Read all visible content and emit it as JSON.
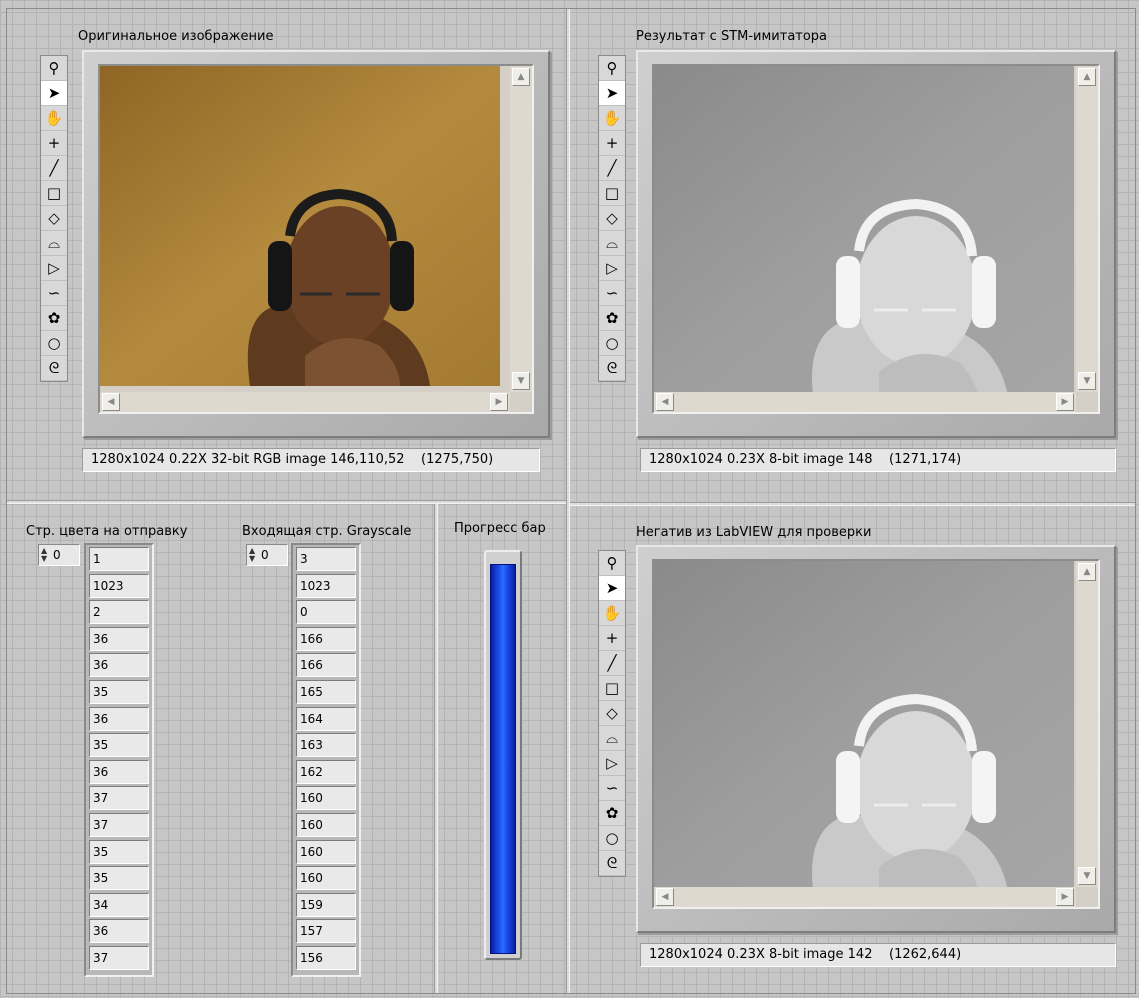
{
  "panels": {
    "original": {
      "title": "Оригинальное изображение",
      "status": "1280x1024 0.22X 32-bit RGB image 146,110,52    (1275,750)"
    },
    "stm_result": {
      "title": "Результат с STM-имитатора",
      "status": "1280x1024 0.23X 8-bit image 148    (1271,174)"
    },
    "negative": {
      "title": "Негатив из LabVIEW для проверки",
      "status": "1280x1024 0.23X 8-bit image 142    (1262,644)"
    }
  },
  "tools": [
    {
      "name": "zoom-icon",
      "glyph": "⚲"
    },
    {
      "name": "pointer-icon",
      "glyph": "➤"
    },
    {
      "name": "pan-hand-icon",
      "glyph": "✋"
    },
    {
      "name": "point-icon",
      "glyph": "+"
    },
    {
      "name": "line-icon",
      "glyph": "╱"
    },
    {
      "name": "rectangle-icon",
      "glyph": "□"
    },
    {
      "name": "rotated-rect-icon",
      "glyph": "◇"
    },
    {
      "name": "annulus-icon",
      "glyph": "⌓"
    },
    {
      "name": "polygon-icon",
      "glyph": "▷"
    },
    {
      "name": "freehand-line-icon",
      "glyph": "∽"
    },
    {
      "name": "freehand-region-icon",
      "glyph": "✿"
    },
    {
      "name": "oval-icon",
      "glyph": "○"
    },
    {
      "name": "spiral-icon",
      "glyph": "ᘓ"
    }
  ],
  "color_array": {
    "label": "Стр. цвета на отправку",
    "index": "0",
    "values": [
      "1",
      "1023",
      "2",
      "36",
      "36",
      "35",
      "36",
      "35",
      "36",
      "37",
      "37",
      "35",
      "35",
      "34",
      "36",
      "37"
    ]
  },
  "gray_array": {
    "label": "Входящая стр. Grayscale",
    "index": "0",
    "values": [
      "3",
      "1023",
      "0",
      "166",
      "166",
      "165",
      "164",
      "163",
      "162",
      "160",
      "160",
      "160",
      "160",
      "159",
      "157",
      "156"
    ]
  },
  "progress": {
    "label": "Прогресс бар",
    "fraction": 0.98,
    "fill_color": "#1c50f0"
  },
  "colors": {
    "background": "#c6c6c6",
    "grid": "#b4b4b4"
  }
}
